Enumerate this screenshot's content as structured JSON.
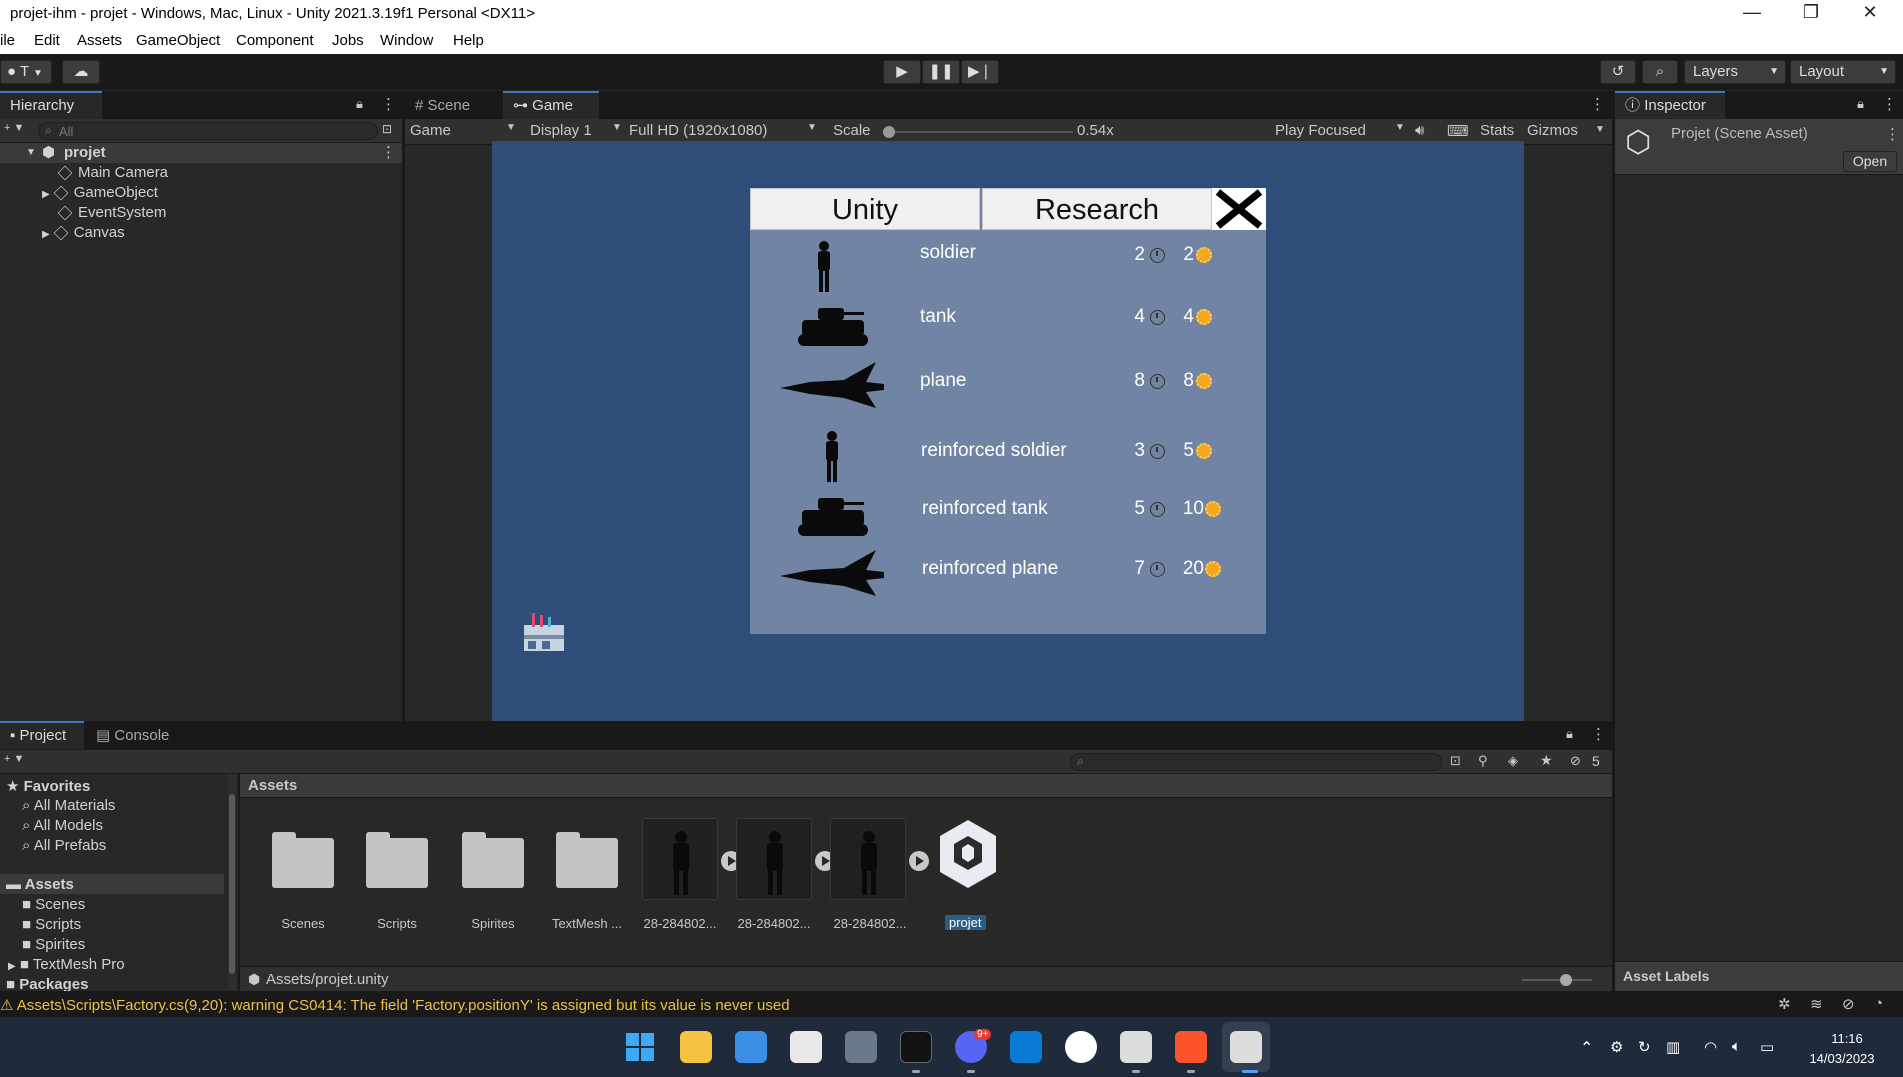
{
  "window": {
    "title": "projet-ihm - projet - Windows, Mac, Linux - Unity 2021.3.19f1 Personal <DX11>",
    "minimize_icon": "—",
    "restore_icon": "❐",
    "close_icon": "✕"
  },
  "menu": [
    "ile",
    "Edit",
    "Assets",
    "GameObject",
    "Component",
    "Jobs",
    "Window",
    "Help"
  ],
  "toolbar": {
    "account_label": "T",
    "layers_label": "Layers",
    "layout_label": "Layout"
  },
  "hierarchy": {
    "tab_label": "Hierarchy",
    "search_placeholder": "All",
    "scene_name": "projet",
    "items": [
      "Main Camera",
      "GameObject",
      "EventSystem",
      "Canvas"
    ]
  },
  "scene_tabs": {
    "scene": "Scene",
    "game": "Game"
  },
  "game_bar": {
    "mode": "Game",
    "display": "Display 1",
    "resolution": "Full HD (1920x1080)",
    "scale_label": "Scale",
    "scale_value": "0.54x",
    "play_focused": "Play Focused",
    "stats": "Stats",
    "gizmos": "Gizmos"
  },
  "game_ui": {
    "tabs": [
      "Unity",
      "Research"
    ],
    "close_icon": "close-x-icon",
    "units": [
      {
        "name": "soldier",
        "time": "2",
        "cost": "2",
        "icon": "soldier-icon"
      },
      {
        "name": "tank",
        "time": "4",
        "cost": "4",
        "icon": "tank-icon"
      },
      {
        "name": "plane",
        "time": "8",
        "cost": "8",
        "icon": "plane-icon"
      },
      {
        "name": "reinforced soldier",
        "time": "3",
        "cost": "5",
        "icon": "soldier-icon"
      },
      {
        "name": "reinforced tank",
        "time": "5",
        "cost": "10",
        "icon": "tank-icon"
      },
      {
        "name": "reinforced plane",
        "time": "7",
        "cost": "20",
        "icon": "plane-icon"
      }
    ]
  },
  "inspector": {
    "tab_label": "Inspector",
    "asset_title": "Projet (Scene Asset)",
    "open_button": "Open",
    "asset_labels": "Asset Labels"
  },
  "project": {
    "tabs": [
      "Project",
      "Console"
    ],
    "hidden_count": "5",
    "favorites_label": "Favorites",
    "favorites": [
      "All Materials",
      "All Models",
      "All Prefabs"
    ],
    "assets_label": "Assets",
    "asset_folders": [
      "Scenes",
      "Scripts",
      "Spirites",
      "TextMesh Pro"
    ],
    "packages_label": "Packages",
    "breadcrumb": "Assets",
    "grid_items": [
      "Scenes",
      "Scripts",
      "Spirites",
      "TextMesh ...",
      "28-284802...",
      "28-284802...",
      "28-284802...",
      "projet"
    ],
    "path": "Assets/projet.unity"
  },
  "status": {
    "warning": "Assets\\Scripts\\Factory.cs(9,20): warning CS0414: The field 'Factory.positionY' is assigned but its value is never used"
  },
  "taskbar": {
    "time": "11:16",
    "date": "14/03/2023",
    "discord_badge": "9+"
  },
  "colors": {
    "game_bg": "#2f4d79",
    "popup_bg": "#7184a3",
    "warning": "#f0c040",
    "selection": "#2c5d87"
  }
}
